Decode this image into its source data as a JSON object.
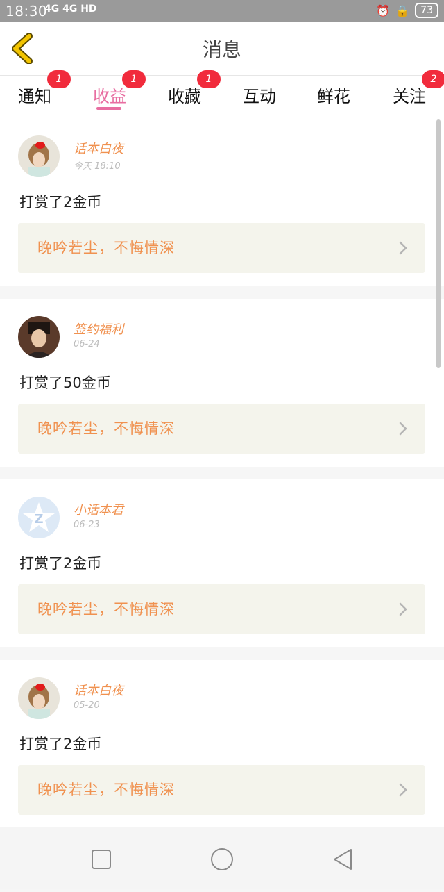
{
  "status_bar": {
    "time": "18:30",
    "signal": "4G 4G HD",
    "battery": "73"
  },
  "header": {
    "title": "消息"
  },
  "tabs": [
    {
      "label": "通知",
      "badge": "1",
      "active": false
    },
    {
      "label": "收益",
      "badge": "1",
      "active": true
    },
    {
      "label": "收藏",
      "badge": "1",
      "active": false
    },
    {
      "label": "互动",
      "badge": "",
      "active": false
    },
    {
      "label": "鲜花",
      "badge": "",
      "active": false
    },
    {
      "label": "关注",
      "badge": "2",
      "active": false
    }
  ],
  "messages": [
    {
      "user": "话本白夜",
      "date": "今天 18:10",
      "action": "打赏了2金币",
      "book": "晚吟若尘，不悔情深",
      "avatar": "girl-avatar"
    },
    {
      "user": "签约福利",
      "date": "06-24",
      "action": "打赏了50金币",
      "book": "晚吟若尘，不悔情深",
      "avatar": "man-avatar"
    },
    {
      "user": "小话本君",
      "date": "06-23",
      "action": "打赏了2金币",
      "book": "晚吟若尘，不悔情深",
      "avatar": "logo-avatar"
    },
    {
      "user": "话本白夜",
      "date": "05-20",
      "action": "打赏了2金币",
      "book": "晚吟若尘，不悔情深",
      "avatar": "girl-avatar"
    }
  ],
  "colors": {
    "accent": "#e86ea1",
    "orange": "#f0914f",
    "badge": "#f12b3c",
    "back_arrow": "#f2c400"
  }
}
